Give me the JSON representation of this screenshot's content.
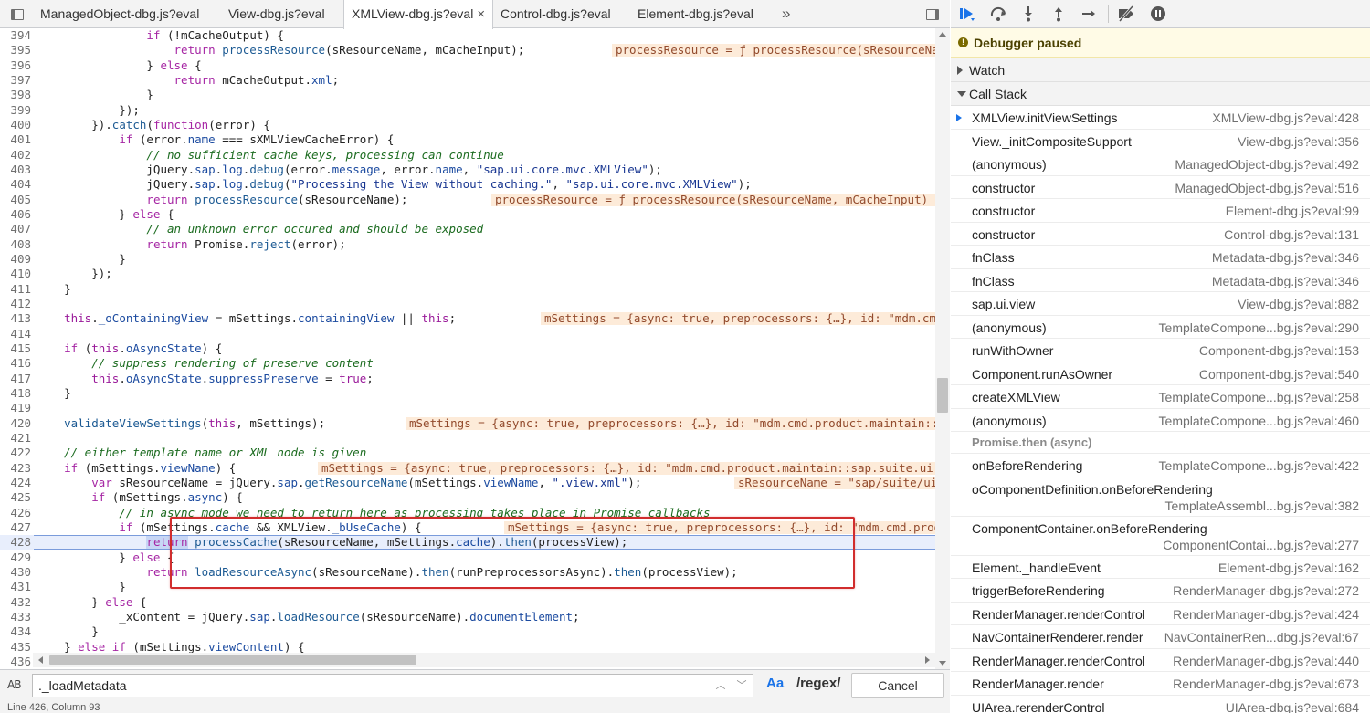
{
  "tabs": [
    {
      "label": "ManagedObject-dbg.js?eval",
      "active": false
    },
    {
      "label": "View-dbg.js?eval",
      "active": false
    },
    {
      "label": "XMLView-dbg.js?eval",
      "active": true,
      "close": "×"
    },
    {
      "label": "Control-dbg.js?eval",
      "active": false
    },
    {
      "label": "Element-dbg.js?eval",
      "active": false
    }
  ],
  "tab_overflow": "»",
  "code_lines": [
    {
      "n": "394",
      "html": "            <span class=\"kw\">if</span> (!mCacheOutput) {"
    },
    {
      "n": "395",
      "html": "                <span class=\"kw\">return</span> <span class=\"fn\">processResource</span>(sResourceName, mCacheInput);"
    },
    {
      "n": "396",
      "html": "            } <span class=\"kw\">else</span> {"
    },
    {
      "n": "397",
      "html": "                <span class=\"kw\">return</span> mCacheOutput.<span class=\"pr\">xml</span>;"
    },
    {
      "n": "398",
      "html": "            }"
    },
    {
      "n": "399",
      "html": "        });"
    },
    {
      "n": "400",
      "html": "    }).<span class=\"fn\">catch</span>(<span class=\"kw\">function</span>(error) {"
    },
    {
      "n": "401",
      "html": "        <span class=\"kw\">if</span> (error.<span class=\"pr\">name</span> === sXMLViewCacheError) {"
    },
    {
      "n": "402",
      "html": "            <span class=\"cm\">// no sufficient cache keys, processing can continue</span>"
    },
    {
      "n": "403",
      "html": "            jQuery.<span class=\"pr\">sap</span>.<span class=\"pr\">log</span>.<span class=\"fn\">debug</span>(error.<span class=\"pr\">message</span>, error.<span class=\"pr\">name</span>, <span class=\"str\">\"sap.ui.core.mvc.XMLView\"</span>);"
    },
    {
      "n": "404",
      "html": "            jQuery.<span class=\"pr\">sap</span>.<span class=\"pr\">log</span>.<span class=\"fn\">debug</span>(<span class=\"str\">\"Processing the View without caching.\"</span>, <span class=\"str\">\"sap.ui.core.mvc.XMLView\"</span>);"
    },
    {
      "n": "405",
      "html": "            <span class=\"kw\">return</span> <span class=\"fn\">processResource</span>(sResourceName);"
    },
    {
      "n": "406",
      "html": "        } <span class=\"kw\">else</span> {"
    },
    {
      "n": "407",
      "html": "            <span class=\"cm\">// an unknown error occured and should be exposed</span>"
    },
    {
      "n": "408",
      "html": "            <span class=\"kw\">return</span> Promise.<span class=\"fn\">reject</span>(error);"
    },
    {
      "n": "409",
      "html": "        }"
    },
    {
      "n": "410",
      "html": "    });"
    },
    {
      "n": "411",
      "html": "}"
    },
    {
      "n": "412",
      "html": ""
    },
    {
      "n": "413",
      "html": "<span class=\"th\">this</span>.<span class=\"pr\">_oContainingView</span> = mSettings.<span class=\"pr\">containingView</span> || <span class=\"th\">this</span>;"
    },
    {
      "n": "414",
      "html": ""
    },
    {
      "n": "415",
      "html": "<span class=\"kw\">if</span> (<span class=\"th\">this</span>.<span class=\"pr\">oAsyncState</span>) {"
    },
    {
      "n": "416",
      "html": "    <span class=\"cm\">// suppress rendering of preserve content</span>"
    },
    {
      "n": "417",
      "html": "    <span class=\"th\">this</span>.<span class=\"pr\">oAsyncState</span>.<span class=\"pr\">suppressPreserve</span> = <span class=\"th\">true</span>;"
    },
    {
      "n": "418",
      "html": "}"
    },
    {
      "n": "419",
      "html": ""
    },
    {
      "n": "420",
      "html": "<span class=\"fn\">validateViewSettings</span>(<span class=\"th\">this</span>, mSettings);"
    },
    {
      "n": "421",
      "html": ""
    },
    {
      "n": "422",
      "html": "<span class=\"cm\">// either template name or XML node is given</span>"
    },
    {
      "n": "423",
      "html": "<span class=\"kw\">if</span> (mSettings.<span class=\"pr\">viewName</span>) {"
    },
    {
      "n": "424",
      "html": "    <span class=\"kw\">var</span> sResourceName = jQuery.<span class=\"pr\">sap</span>.<span class=\"fn\">getResourceName</span>(mSettings.<span class=\"pr\">viewName</span>, <span class=\"str\">\".view.xml\"</span>);"
    },
    {
      "n": "425",
      "html": "    <span class=\"kw\">if</span> (mSettings.<span class=\"pr\">async</span>) {"
    },
    {
      "n": "426",
      "html": "        <span class=\"cm\">// in async mode we need to return here as processing takes place in Promise callbacks</span>"
    },
    {
      "n": "427",
      "html": "        <span class=\"kw\">if</span> (mSettings.<span class=\"pr\">cache</span> &amp;&amp; XMLView.<span class=\"pr\">_bUseCache</span>) {"
    },
    {
      "n": "428",
      "html": "            <span class=\"kw\" style=\"background:#c7d6f5\">return</span> <span class=\"fn\">processCache</span>(sResourceName, mSettings.<span class=\"pr\">cache</span>).<span class=\"fn\">then</span>(processView);"
    },
    {
      "n": "429",
      "html": "        } <span class=\"kw\">else</span> {"
    },
    {
      "n": "430",
      "html": "            <span class=\"kw\">return</span> <span class=\"fn\">loadResourceAsync</span>(sResourceName).<span class=\"fn\">then</span>(runPreprocessorsAsync).<span class=\"fn\">then</span>(processView);"
    },
    {
      "n": "431",
      "html": "        }"
    },
    {
      "n": "432",
      "html": "    } <span class=\"kw\">else</span> {"
    },
    {
      "n": "433",
      "html": "        _xContent = jQuery.<span class=\"pr\">sap</span>.<span class=\"fn\">loadResource</span>(sResourceName).<span class=\"pr\">documentElement</span>;"
    },
    {
      "n": "434",
      "html": "    }"
    },
    {
      "n": "435",
      "html": "} <span class=\"kw\">else</span> <span class=\"kw\">if</span> (mSettings.<span class=\"pr\">viewContent</span>) {"
    },
    {
      "n": "436",
      "html": ""
    }
  ],
  "inline_values": [
    {
      "line": "395",
      "text": "processResource = ƒ processResource(sResourceName, mCacheInput)"
    },
    {
      "line": "405",
      "text": "processResource = ƒ processResource(sResourceName, mCacheInput)"
    },
    {
      "line": "413",
      "text": "mSettings = {async: true, preprocessors: {…}, id: \"mdm.cmd.product.maintain::sap.suite.ui.generic.template.ListReport.view.ListReport::C_Product\"}"
    },
    {
      "line": "420",
      "text": "mSettings = {async: true, preprocessors: {…}, id: \"mdm.cmd.product.maintain::sap.suite.ui.generic.template.ListReport.view.ListReport::C_Product\"}"
    },
    {
      "line": "423",
      "text": "mSettings = {async: true, preprocessors: {…}, id: \"mdm.cmd.product.maintain::sap.suite.ui.generic.template.ListReport.view.ListReport::C_Product\"}"
    },
    {
      "line": "424",
      "text": "sResourceName = \"sap/suite/ui/generic/template/ListReport/view/ListReport.view.xml\""
    },
    {
      "line": "427",
      "text": "mSettings = {async: true, preprocessors: {…}, id: \"mdm.cmd.product.maintain::sap.suite.ui.generic.template.ListReport.view.ListReport::C_Product\"}"
    }
  ],
  "search": {
    "value": "._loadMetadata",
    "mode_icon": "AB",
    "match_case": "Aa",
    "regex": "/regex/",
    "cancel": "Cancel",
    "prev": "︿",
    "next": "﹀"
  },
  "status": {
    "cursor": "Line 426, Column 93"
  },
  "debugger": {
    "paused_label": "Debugger paused",
    "paused_icon": "!",
    "watch_label": "Watch",
    "callstack_label": "Call Stack",
    "async_label": "Promise.then (async)"
  },
  "call_stack_sync": [
    {
      "fn": "XMLView.initViewSettings",
      "loc": "XMLView-dbg.js?eval:428",
      "current": true
    },
    {
      "fn": "View._initCompositeSupport",
      "loc": "View-dbg.js?eval:356"
    },
    {
      "fn": "(anonymous)",
      "loc": "ManagedObject-dbg.js?eval:492"
    },
    {
      "fn": "constructor",
      "loc": "ManagedObject-dbg.js?eval:516"
    },
    {
      "fn": "constructor",
      "loc": "Element-dbg.js?eval:99"
    },
    {
      "fn": "constructor",
      "loc": "Control-dbg.js?eval:131"
    },
    {
      "fn": "fnClass",
      "loc": "Metadata-dbg.js?eval:346"
    },
    {
      "fn": "fnClass",
      "loc": "Metadata-dbg.js?eval:346"
    },
    {
      "fn": "sap.ui.view",
      "loc": "View-dbg.js?eval:882"
    },
    {
      "fn": "(anonymous)",
      "loc": "TemplateCompone...bg.js?eval:290"
    },
    {
      "fn": "runWithOwner",
      "loc": "Component-dbg.js?eval:153"
    },
    {
      "fn": "Component.runAsOwner",
      "loc": "Component-dbg.js?eval:540"
    },
    {
      "fn": "createXMLView",
      "loc": "TemplateCompone...bg.js?eval:258"
    },
    {
      "fn": "(anonymous)",
      "loc": "TemplateCompone...bg.js?eval:460"
    }
  ],
  "call_stack_async": [
    {
      "fn": "onBeforeRendering",
      "loc": "TemplateCompone...bg.js?eval:422"
    },
    {
      "fn": "oComponentDefinition.onBeforeRendering",
      "loc": "TemplateAssembl...bg.js?eval:382",
      "tall": true
    },
    {
      "fn": "ComponentContainer.onBeforeRendering",
      "loc": "ComponentContai...bg.js?eval:277",
      "tall": true
    },
    {
      "fn": "Element._handleEvent",
      "loc": "Element-dbg.js?eval:162"
    },
    {
      "fn": "triggerBeforeRendering",
      "loc": "RenderManager-dbg.js?eval:272"
    },
    {
      "fn": "RenderManager.renderControl",
      "loc": "RenderManager-dbg.js?eval:424"
    },
    {
      "fn": "NavContainerRenderer.render",
      "loc": "NavContainerRen...dbg.js?eval:67"
    },
    {
      "fn": "RenderManager.renderControl",
      "loc": "RenderManager-dbg.js?eval:440"
    },
    {
      "fn": "RenderManager.render",
      "loc": "RenderManager-dbg.js?eval:673"
    },
    {
      "fn": "UIArea.rerenderControl",
      "loc": "UIArea-dbg.js?eval:684"
    }
  ],
  "colors": {
    "accent": "#1a73e8",
    "highlight_box": "#d12d2d",
    "paused_banner": "#fffbe6",
    "inline_value_bg": "#fdebd9"
  }
}
